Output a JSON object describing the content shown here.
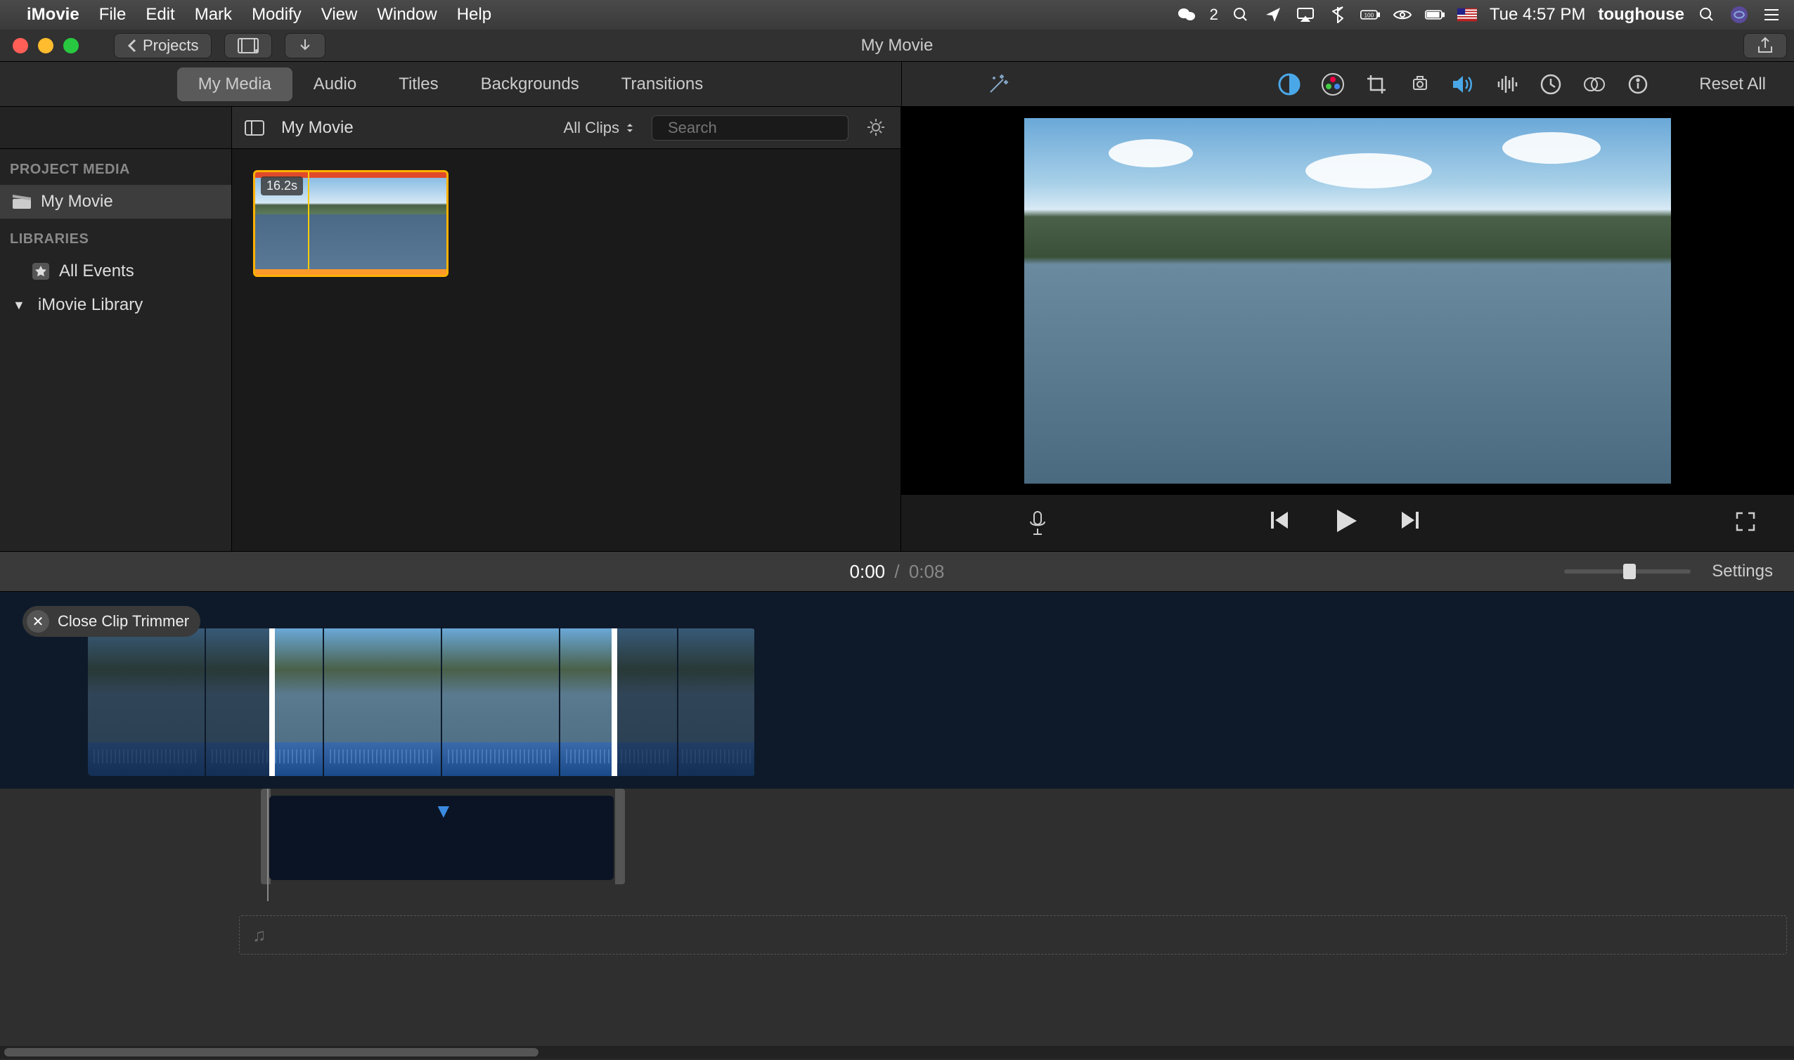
{
  "menubar": {
    "app": "iMovie",
    "items": [
      "File",
      "Edit",
      "Mark",
      "Modify",
      "View",
      "Window",
      "Help"
    ],
    "status": {
      "wechat_count": "2",
      "datetime": "Tue 4:57 PM",
      "username": "toughouse"
    }
  },
  "window": {
    "back_label": "Projects",
    "title": "My Movie"
  },
  "tabs": {
    "items": [
      "My Media",
      "Audio",
      "Titles",
      "Backgrounds",
      "Transitions"
    ],
    "active": "My Media",
    "reset_all": "Reset All"
  },
  "sidebar": {
    "project_media_label": "PROJECT MEDIA",
    "project_item": "My Movie",
    "libraries_label": "LIBRARIES",
    "all_events": "All Events",
    "library": "iMovie Library"
  },
  "browser": {
    "title": "My Movie",
    "filter": "All Clips",
    "search_placeholder": "Search",
    "clip": {
      "duration": "16.2s"
    }
  },
  "timeline_header": {
    "current": "0:00",
    "separator": "/",
    "total": "0:08",
    "settings": "Settings"
  },
  "trimmer": {
    "close_label": "Close Clip Trimmer"
  }
}
